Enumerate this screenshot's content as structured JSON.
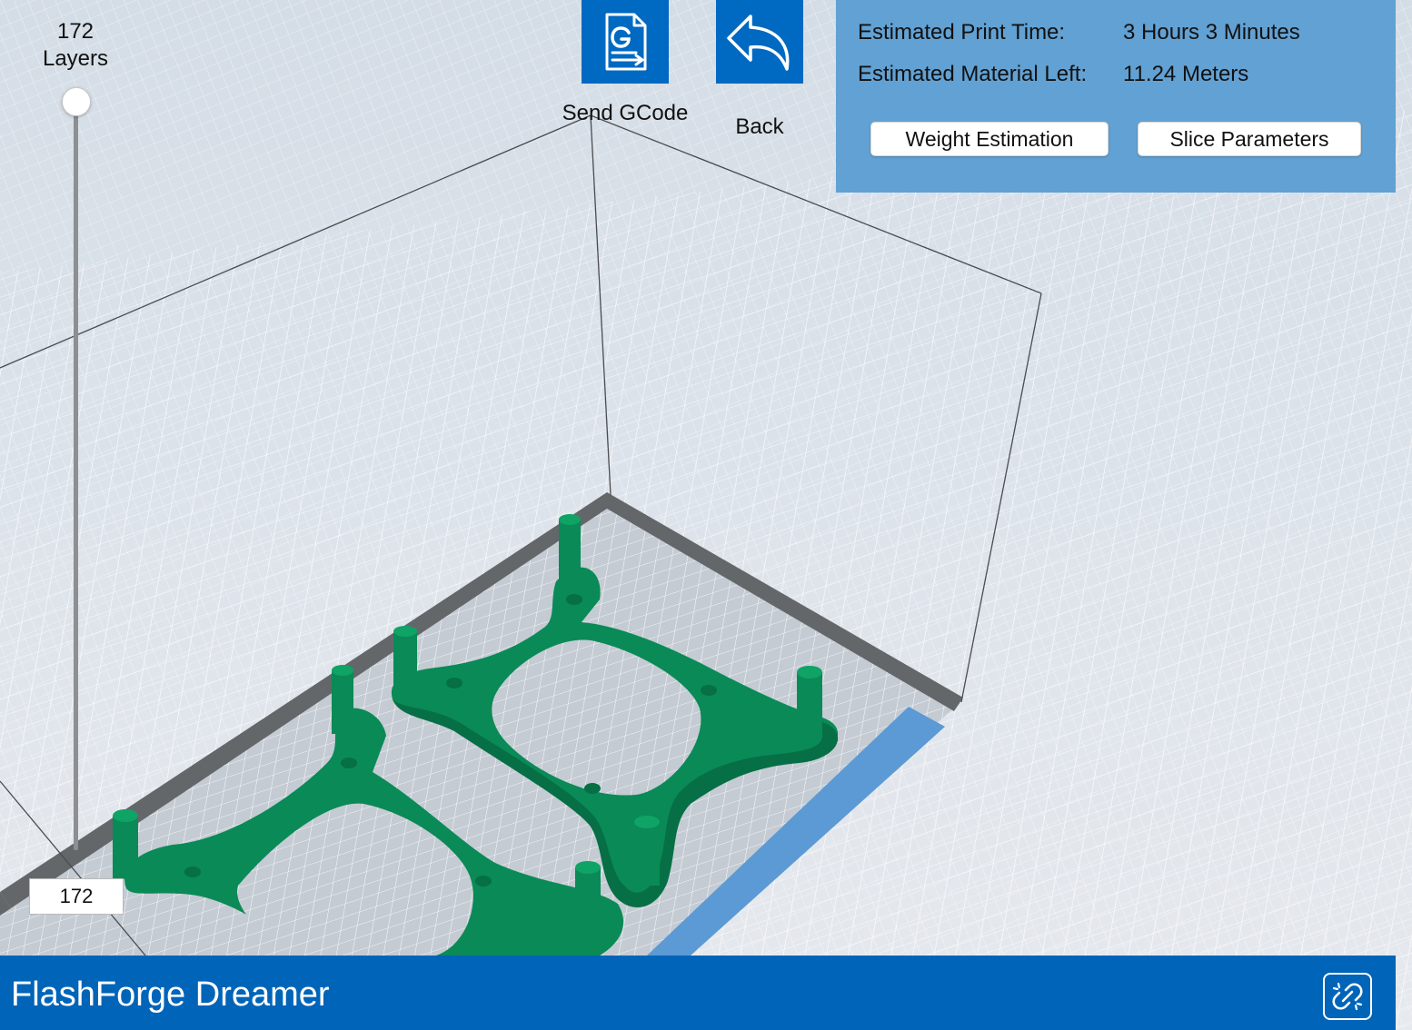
{
  "layers": {
    "count": "172",
    "unit": "Layers",
    "current": "172",
    "slider_position": 1.0
  },
  "toolbar": {
    "send_gcode": {
      "label": "Send GCode",
      "icon": "gcode-file-send-icon"
    },
    "back": {
      "label": "Back",
      "icon": "undo-arrow-icon"
    }
  },
  "estimates": {
    "print_time_label": "Estimated Print Time:",
    "print_time_value": "3 Hours 3 Minutes",
    "material_label": "Estimated Material Left:",
    "material_value": "11.24 Meters"
  },
  "panel_buttons": {
    "weight": "Weight Estimation",
    "slice": "Slice Parameters"
  },
  "footer": {
    "printer_name": "FlashForge Dreamer",
    "connection_icon": "broken-link-icon"
  },
  "colors": {
    "toolbar_blue": "#0069c2",
    "panel_blue": "#62a1d3",
    "footer_blue": "#0064b8",
    "model_green": "#0b8a57",
    "platform_edge_dark": "#616468",
    "platform_edge_blue": "#5b9ad4"
  }
}
